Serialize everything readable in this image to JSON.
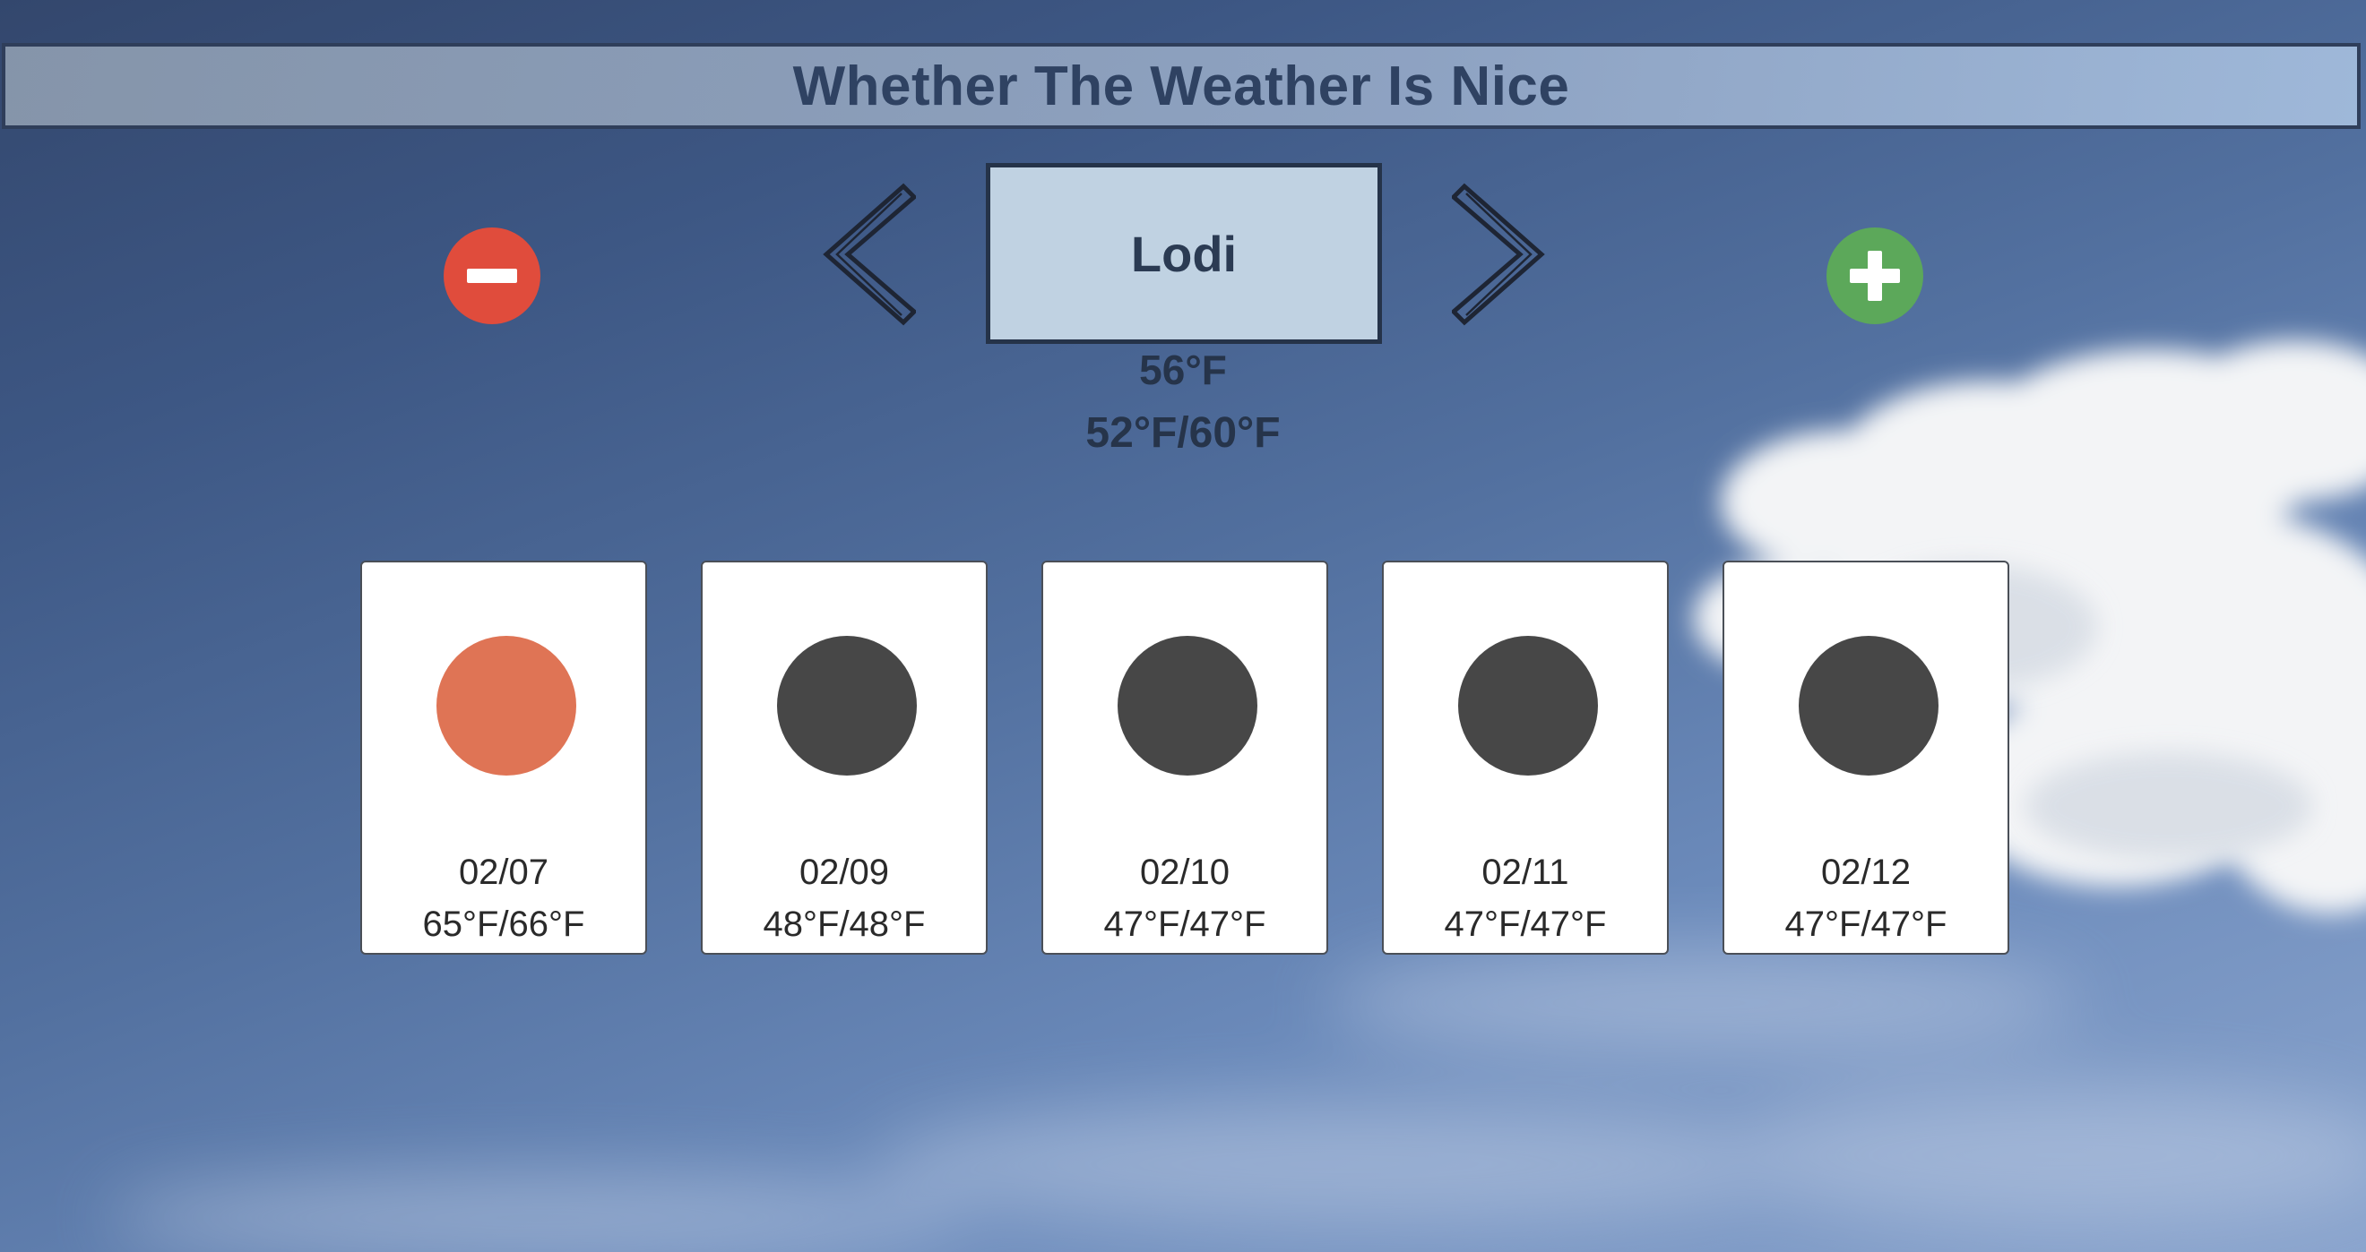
{
  "app": {
    "title": "Whether The Weather Is Nice"
  },
  "controls": {
    "remove_icon": "minus-icon",
    "add_icon": "plus-icon",
    "prev_icon": "chevron-left-icon",
    "next_icon": "chevron-right-icon",
    "remove_color": "#e04c3c",
    "add_color": "#5ca85a"
  },
  "location": {
    "city": "Lodi",
    "current_temp": "56°F",
    "range": "52°F/60°F"
  },
  "forecast": [
    {
      "date": "02/07",
      "range": "65°F/66°F",
      "dot_color": "#df7455"
    },
    {
      "date": "02/09",
      "range": "48°F/48°F",
      "dot_color": "#474747"
    },
    {
      "date": "02/10",
      "range": "47°F/47°F",
      "dot_color": "#474747"
    },
    {
      "date": "02/11",
      "range": "47°F/47°F",
      "dot_color": "#474747"
    },
    {
      "date": "02/12",
      "range": "47°F/47°F",
      "dot_color": "#474747"
    }
  ]
}
